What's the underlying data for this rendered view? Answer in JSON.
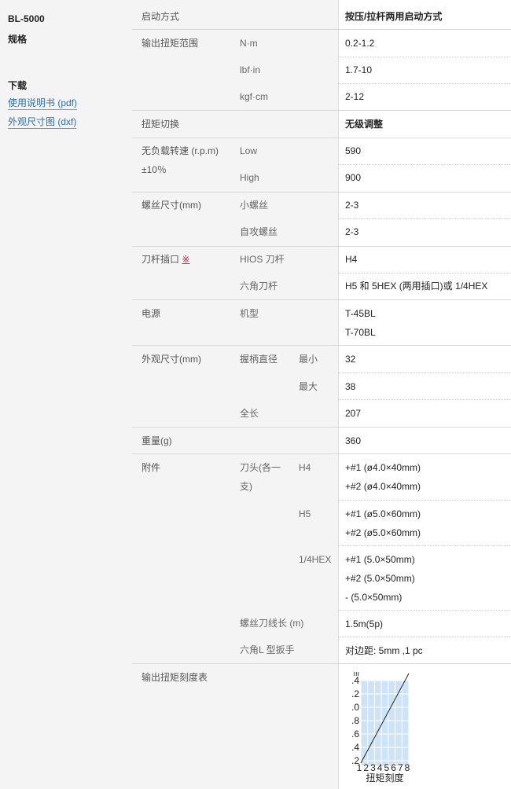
{
  "sidebar": {
    "model": "BL-5000",
    "spec_title": "规格",
    "download_title": "下载",
    "links": [
      "使用说明书 (pdf)",
      "外观尺寸图 (dxf)"
    ]
  },
  "spec": {
    "start_method": {
      "label": "启动方式",
      "value": "按压/拉杆两用启动方式"
    },
    "torque_range": {
      "label": "输出扭矩范围",
      "rows": [
        {
          "unit": "N·m",
          "value": "0.2-1.2"
        },
        {
          "unit": "lbf·in",
          "value": "1.7-10"
        },
        {
          "unit": "kgf·cm",
          "value": "2-12"
        }
      ]
    },
    "torque_switch": {
      "label": "扭矩切换",
      "value": "无级调整"
    },
    "speed": {
      "label": "无负载转速 (r.p.m)",
      "label2": "±10％",
      "rows": [
        {
          "mode": "Low",
          "value": "590"
        },
        {
          "mode": "High",
          "value": "900"
        }
      ]
    },
    "screw_size": {
      "label": "螺丝尺寸(mm)",
      "rows": [
        {
          "type": "小螺丝",
          "value": "2-3"
        },
        {
          "type": "自攻螺丝",
          "value": "2-3"
        }
      ]
    },
    "bit_insert": {
      "label": "刀杆插口",
      "mark": "※",
      "rows": [
        {
          "type": "HIOS 刀杆",
          "value": "H4"
        },
        {
          "type": "六角刀杆",
          "value": "H5 和 5HEX (两用插口)或 1/4HEX"
        }
      ]
    },
    "power": {
      "label": "电源",
      "sub": "机型",
      "values": [
        "T-45BL",
        "T-70BL"
      ]
    },
    "dimensions": {
      "label": "外观尺寸(mm)",
      "grip": "握柄直径",
      "min": "最小",
      "min_value": "32",
      "max": "最大",
      "max_value": "38",
      "length": "全长",
      "length_value": "207"
    },
    "weight": {
      "label": "重量(g)",
      "value": "360"
    },
    "accessories": {
      "label": "附件",
      "bit_label": "刀头(各一",
      "bit_label2": "支)",
      "groups": [
        {
          "type": "H4",
          "values": [
            "+#1 (ø4.0×40mm)",
            "+#2 (ø4.0×40mm)"
          ]
        },
        {
          "type": "H5",
          "values": [
            "+#1 (ø5.0×60mm)",
            "+#2 (ø5.0×60mm)"
          ]
        },
        {
          "type": "1/4HEX",
          "values": [
            "+#1 (5.0×50mm)",
            "+#2 (5.0×50mm)",
            "- (5.0×50mm)"
          ]
        }
      ],
      "cable": {
        "label": "螺丝刀线长 (m)",
        "value": "1.5m(5p)"
      },
      "wrench": {
        "label": "六角L 型扳手",
        "value": "对边距: 5mm ,1 pc"
      }
    },
    "torque_chart": {
      "label": "输出扭矩刻度表"
    }
  },
  "chart_data": {
    "type": "line",
    "title": "",
    "xlabel": "扭矩刻度",
    "ylabel": "",
    "x_ticks": [
      "1",
      "2",
      "3",
      "4",
      "5",
      "6",
      "7",
      "8"
    ],
    "y_ticks": [
      ".2",
      ".4",
      ".6",
      ".8",
      ".0",
      ".2",
      ".4"
    ],
    "y_top_label": "ııı",
    "x": [
      1,
      8
    ],
    "y": [
      1,
      7
    ],
    "xlim": [
      1,
      8
    ],
    "ylim": [
      1,
      7
    ],
    "grid": true,
    "colors": {
      "line": "#222222",
      "plot_bg": "#cfe3f6",
      "grid": "#ffffff"
    }
  }
}
